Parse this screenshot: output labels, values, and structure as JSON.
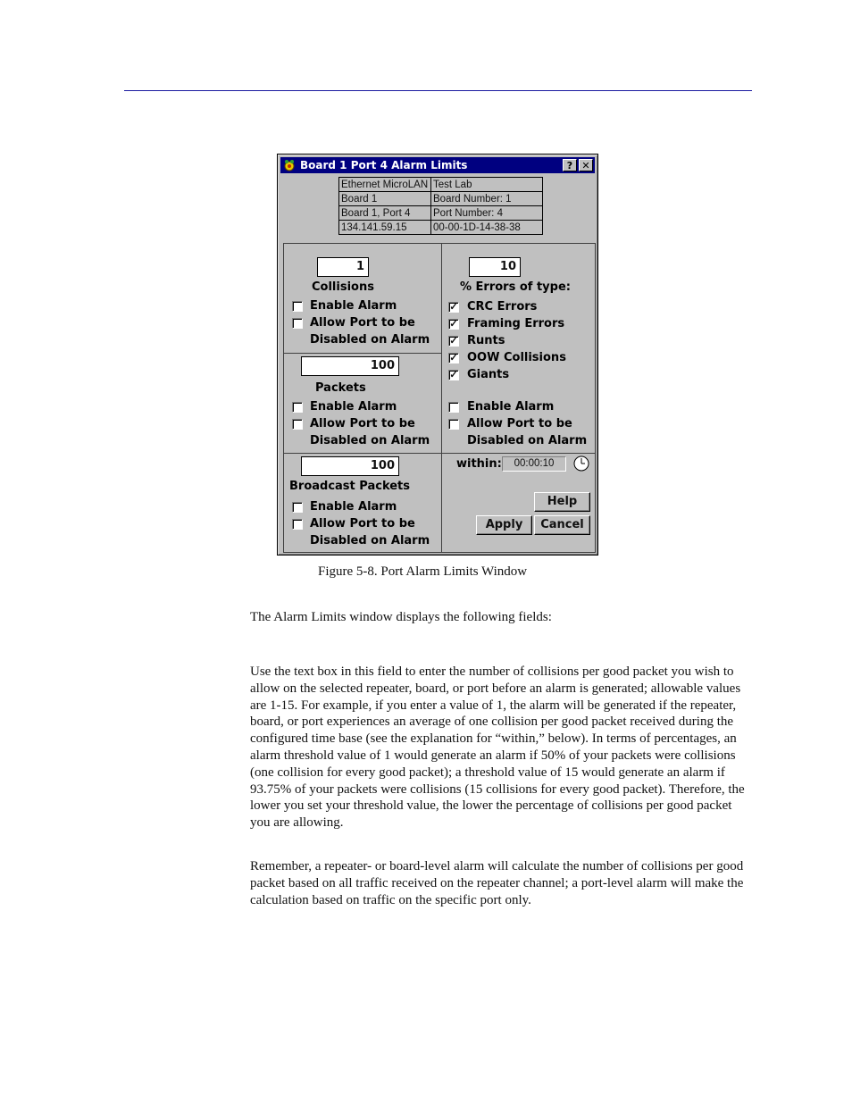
{
  "window": {
    "title": "Board 1 Port 4 Alarm Limits",
    "help_btn": "?",
    "close_btn": "✕",
    "info_table": [
      [
        "Ethernet MicroLAN",
        "Test Lab"
      ],
      [
        "Board 1",
        "Board Number:  1"
      ],
      [
        "Board 1, Port 4",
        "Port Number:  4"
      ],
      [
        "134.141.59.15",
        "00-00-1D-14-38-38"
      ]
    ],
    "collisions": {
      "value": "1",
      "label": "Collisions",
      "enable_alarm": "Enable Alarm",
      "allow_disable_1": "Allow Port to be",
      "allow_disable_2": "Disabled on Alarm",
      "enable_checked": false,
      "disable_checked": false
    },
    "packets": {
      "value": "100",
      "label": "Packets",
      "enable_alarm": "Enable Alarm",
      "allow_disable_1": "Allow Port to be",
      "allow_disable_2": "Disabled on Alarm",
      "enable_checked": false,
      "disable_checked": false
    },
    "broadcast": {
      "value": "100",
      "label": "Broadcast Packets",
      "enable_alarm": "Enable Alarm",
      "allow_disable_1": "Allow Port to be",
      "allow_disable_2": "Disabled on Alarm",
      "enable_checked": false,
      "disable_checked": false
    },
    "errors": {
      "value": "10",
      "label": "% Errors of type:",
      "types": [
        {
          "label": "CRC Errors",
          "checked": true
        },
        {
          "label": "Framing Errors",
          "checked": true
        },
        {
          "label": "Runts",
          "checked": true
        },
        {
          "label": "OOW Collisions",
          "checked": true
        },
        {
          "label": "Giants",
          "checked": true
        }
      ],
      "enable_alarm": "Enable Alarm",
      "allow_disable_1": "Allow Port to be",
      "allow_disable_2": "Disabled on Alarm",
      "enable_checked": false,
      "disable_checked": false
    },
    "within_label": "within:",
    "within_value": "00:00:10",
    "buttons": {
      "help": "Help",
      "apply": "Apply",
      "cancel": "Cancel"
    }
  },
  "caption": "Figure 5-8.  Port Alarm Limits Window",
  "intro": "The Alarm Limits window displays the following fields:",
  "para1": "Use the text box in this field to enter the number of collisions per good packet you wish to allow on the selected repeater, board, or port before an alarm is generated; allowable values are 1-15. For example, if you enter a value of 1, the alarm will be generated if the repeater, board, or port experiences an average of one collision per good packet received during the configured time base (see the explanation for “within,” below). In terms of percentages, an alarm threshold value of 1 would generate an alarm if 50% of your packets were collisions (one collision for every good packet); a threshold value of 15 would generate an alarm if 93.75% of your packets were collisions (15 collisions for every good packet). Therefore, the lower you set your threshold value, the lower the percentage of collisions per good packet you are allowing.",
  "para2": "Remember, a repeater- or board-level alarm will calculate the number of collisions per good packet based on all traffic received on the repeater channel; a port-level alarm will make the calculation based on traffic on the specific port only."
}
